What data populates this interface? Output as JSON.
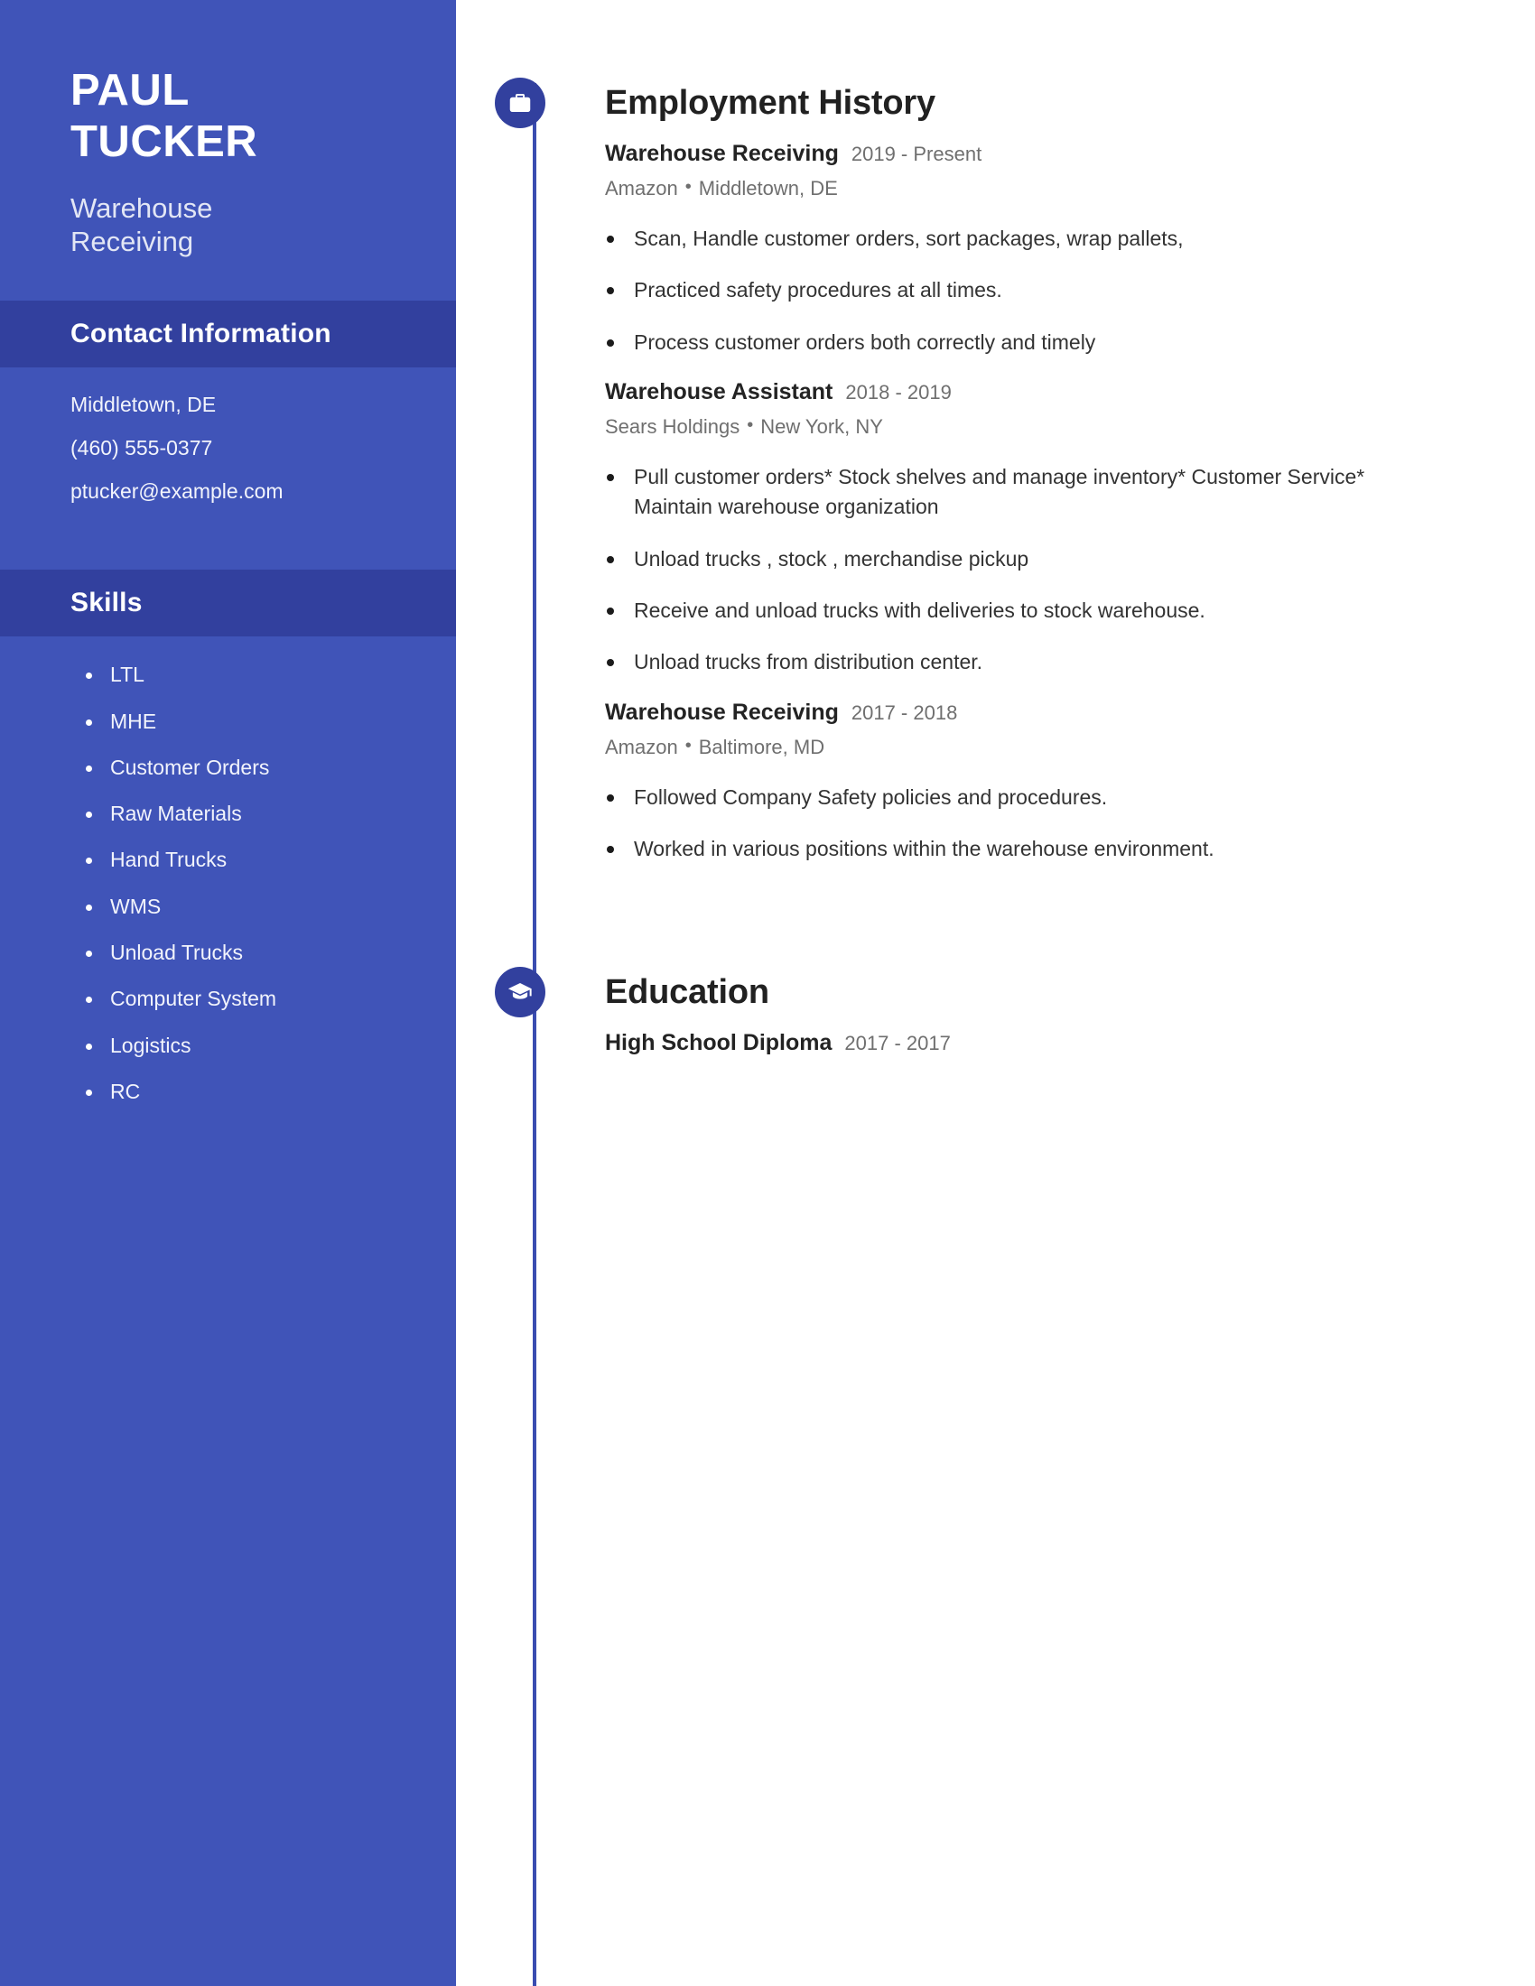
{
  "sidebar": {
    "name_lines": [
      "PAUL",
      "TUCKER"
    ],
    "job_title_lines": [
      "Warehouse",
      "Receiving"
    ],
    "contact": {
      "heading": "Contact Information",
      "items": [
        {
          "value": "Middletown, DE",
          "kind": "location"
        },
        {
          "value": "(460) 555-0377",
          "kind": "phone"
        },
        {
          "value": "ptucker@example.com",
          "kind": "email"
        }
      ]
    },
    "skills": {
      "heading": "Skills",
      "items": [
        "LTL",
        "MHE",
        "Customer Orders",
        "Raw Materials",
        "Hand Trucks",
        "WMS",
        "Unload Trucks",
        "Computer System",
        "Logistics",
        "RC"
      ]
    }
  },
  "main": {
    "employment": {
      "heading": "Employment History",
      "icon": "briefcase-icon",
      "entries": [
        {
          "role": "Warehouse Receiving",
          "dates": "2019 - Present",
          "company": "Amazon",
          "location": "Middletown, DE",
          "bullets": [
            "Scan, Handle customer orders, sort packages, wrap pallets,",
            "Practiced safety procedures at all times.",
            "Process customer orders both correctly and timely"
          ]
        },
        {
          "role": "Warehouse Assistant",
          "dates": "2018 - 2019",
          "company": "Sears Holdings",
          "location": "New York, NY",
          "bullets": [
            "Pull customer orders* Stock shelves and manage inventory* Customer Service* Maintain warehouse organization",
            "Unload trucks , stock , merchandise pickup",
            "Receive and unload trucks with deliveries to stock warehouse.",
            "Unload trucks from distribution center."
          ]
        },
        {
          "role": "Warehouse Receiving",
          "dates": "2017 - 2018",
          "company": "Amazon",
          "location": "Baltimore, MD",
          "bullets": [
            "Followed Company Safety policies and procedures.",
            "Worked in various positions within the warehouse environment."
          ]
        }
      ]
    },
    "education": {
      "heading": "Education",
      "icon": "graduation-cap-icon",
      "entries": [
        {
          "degree": "High School Diploma",
          "dates": "2017 - 2017"
        }
      ]
    },
    "separator": "•"
  },
  "colors": {
    "sidebar_bg": "#4054b8",
    "sidebar_band": "#32409e",
    "accent": "#32409e",
    "timeline": "#3a4cb0",
    "text_dark": "#232323",
    "text_muted": "#6f6f6f"
  }
}
